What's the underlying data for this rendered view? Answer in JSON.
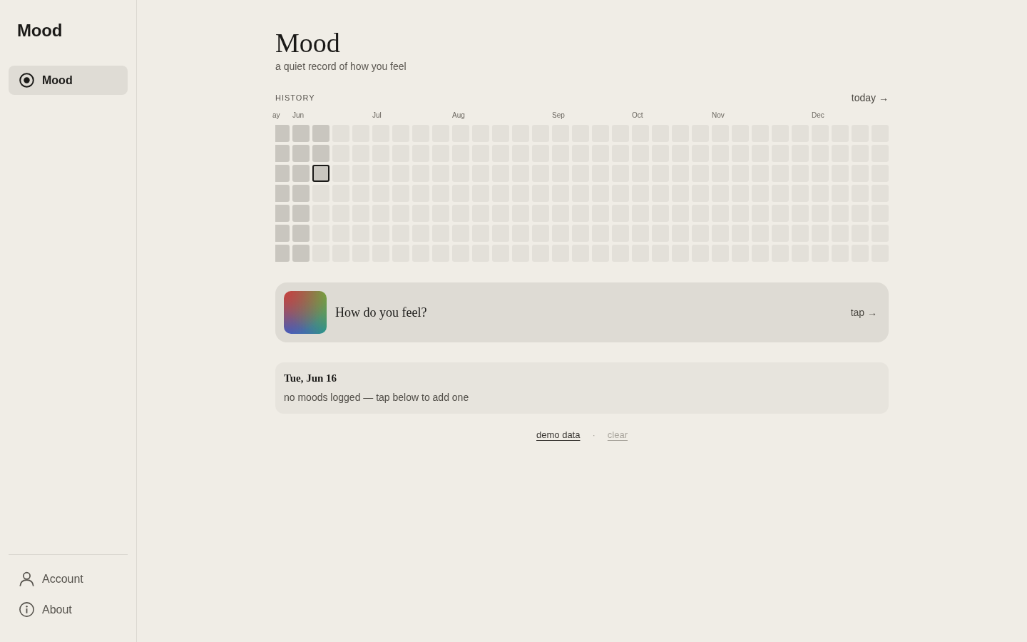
{
  "sidebar": {
    "logo": "Mood",
    "nav": [
      {
        "label": "Mood",
        "selected": true
      }
    ],
    "footer_nav": [
      {
        "label": "Account",
        "selected": false
      },
      {
        "label": "About",
        "selected": false
      }
    ]
  },
  "header": {
    "title": "Mood",
    "subtitle": "a quiet record of how you feel"
  },
  "history": {
    "label": "HISTORY",
    "today_link": "today →",
    "weeks": [
      {
        "month": "ay",
        "days": [
          {
            "past": true,
            "selected": false
          },
          {
            "past": true,
            "selected": false
          },
          {
            "past": true,
            "selected": false
          },
          {
            "past": true,
            "selected": false
          },
          {
            "past": true,
            "selected": false
          },
          {
            "past": true,
            "selected": false
          },
          {
            "past": true,
            "selected": false
          }
        ]
      },
      {
        "month": "Jun",
        "days": [
          {
            "past": true,
            "selected": false
          },
          {
            "past": true,
            "selected": false
          },
          {
            "past": true,
            "selected": false
          },
          {
            "past": true,
            "selected": false
          },
          {
            "past": true,
            "selected": false
          },
          {
            "past": true,
            "selected": false
          },
          {
            "past": true,
            "selected": false
          }
        ]
      },
      {
        "days": [
          {
            "past": true,
            "selected": false
          },
          {
            "past": true,
            "selected": false
          },
          {
            "past": true,
            "selected": true
          },
          {
            "past": false,
            "selected": false
          },
          {
            "past": false,
            "selected": false
          },
          {
            "past": false,
            "selected": false
          },
          {
            "past": false,
            "selected": false
          }
        ]
      },
      {
        "days": [
          {
            "past": false,
            "selected": false
          },
          {
            "past": false,
            "selected": false
          },
          {
            "past": false,
            "selected": false
          },
          {
            "past": false,
            "selected": false
          },
          {
            "past": false,
            "selected": false
          },
          {
            "past": false,
            "selected": false
          },
          {
            "past": false,
            "selected": false
          }
        ]
      },
      {
        "days": [
          {
            "past": false,
            "selected": false
          },
          {
            "past": false,
            "selected": false
          },
          {
            "past": false,
            "selected": false
          },
          {
            "past": false,
            "selected": false
          },
          {
            "past": false,
            "selected": false
          },
          {
            "past": false,
            "selected": false
          },
          {
            "past": false,
            "selected": false
          }
        ]
      },
      {
        "month": "Jul",
        "days": [
          {
            "past": false,
            "selected": false
          },
          {
            "past": false,
            "selected": false
          },
          {
            "past": false,
            "selected": false
          },
          {
            "past": false,
            "selected": false
          },
          {
            "past": false,
            "selected": false
          },
          {
            "past": false,
            "selected": false
          },
          {
            "past": false,
            "selected": false
          }
        ]
      },
      {
        "days": [
          {
            "past": false,
            "selected": false
          },
          {
            "past": false,
            "selected": false
          },
          {
            "past": false,
            "selected": false
          },
          {
            "past": false,
            "selected": false
          },
          {
            "past": false,
            "selected": false
          },
          {
            "past": false,
            "selected": false
          },
          {
            "past": false,
            "selected": false
          }
        ]
      },
      {
        "days": [
          {
            "past": false,
            "selected": false
          },
          {
            "past": false,
            "selected": false
          },
          {
            "past": false,
            "selected": false
          },
          {
            "past": false,
            "selected": false
          },
          {
            "past": false,
            "selected": false
          },
          {
            "past": false,
            "selected": false
          },
          {
            "past": false,
            "selected": false
          }
        ]
      },
      {
        "days": [
          {
            "past": false,
            "selected": false
          },
          {
            "past": false,
            "selected": false
          },
          {
            "past": false,
            "selected": false
          },
          {
            "past": false,
            "selected": false
          },
          {
            "past": false,
            "selected": false
          },
          {
            "past": false,
            "selected": false
          },
          {
            "past": false,
            "selected": false
          }
        ]
      },
      {
        "month": "Aug",
        "days": [
          {
            "past": false,
            "selected": false
          },
          {
            "past": false,
            "selected": false
          },
          {
            "past": false,
            "selected": false
          },
          {
            "past": false,
            "selected": false
          },
          {
            "past": false,
            "selected": false
          },
          {
            "past": false,
            "selected": false
          },
          {
            "past": false,
            "selected": false
          }
        ]
      },
      {
        "days": [
          {
            "past": false,
            "selected": false
          },
          {
            "past": false,
            "selected": false
          },
          {
            "past": false,
            "selected": false
          },
          {
            "past": false,
            "selected": false
          },
          {
            "past": false,
            "selected": false
          },
          {
            "past": false,
            "selected": false
          },
          {
            "past": false,
            "selected": false
          }
        ]
      },
      {
        "days": [
          {
            "past": false,
            "selected": false
          },
          {
            "past": false,
            "selected": false
          },
          {
            "past": false,
            "selected": false
          },
          {
            "past": false,
            "selected": false
          },
          {
            "past": false,
            "selected": false
          },
          {
            "past": false,
            "selected": false
          },
          {
            "past": false,
            "selected": false
          }
        ]
      },
      {
        "days": [
          {
            "past": false,
            "selected": false
          },
          {
            "past": false,
            "selected": false
          },
          {
            "past": false,
            "selected": false
          },
          {
            "past": false,
            "selected": false
          },
          {
            "past": false,
            "selected": false
          },
          {
            "past": false,
            "selected": false
          },
          {
            "past": false,
            "selected": false
          }
        ]
      },
      {
        "days": [
          {
            "past": false,
            "selected": false
          },
          {
            "past": false,
            "selected": false
          },
          {
            "past": false,
            "selected": false
          },
          {
            "past": false,
            "selected": false
          },
          {
            "past": false,
            "selected": false
          },
          {
            "past": false,
            "selected": false
          },
          {
            "past": false,
            "selected": false
          }
        ]
      },
      {
        "month": "Sep",
        "days": [
          {
            "past": false,
            "selected": false
          },
          {
            "past": false,
            "selected": false
          },
          {
            "past": false,
            "selected": false
          },
          {
            "past": false,
            "selected": false
          },
          {
            "past": false,
            "selected": false
          },
          {
            "past": false,
            "selected": false
          },
          {
            "past": false,
            "selected": false
          }
        ]
      },
      {
        "days": [
          {
            "past": false,
            "selected": false
          },
          {
            "past": false,
            "selected": false
          },
          {
            "past": false,
            "selected": false
          },
          {
            "past": false,
            "selected": false
          },
          {
            "past": false,
            "selected": false
          },
          {
            "past": false,
            "selected": false
          },
          {
            "past": false,
            "selected": false
          }
        ]
      },
      {
        "days": [
          {
            "past": false,
            "selected": false
          },
          {
            "past": false,
            "selected": false
          },
          {
            "past": false,
            "selected": false
          },
          {
            "past": false,
            "selected": false
          },
          {
            "past": false,
            "selected": false
          },
          {
            "past": false,
            "selected": false
          },
          {
            "past": false,
            "selected": false
          }
        ]
      },
      {
        "days": [
          {
            "past": false,
            "selected": false
          },
          {
            "past": false,
            "selected": false
          },
          {
            "past": false,
            "selected": false
          },
          {
            "past": false,
            "selected": false
          },
          {
            "past": false,
            "selected": false
          },
          {
            "past": false,
            "selected": false
          },
          {
            "past": false,
            "selected": false
          }
        ]
      },
      {
        "month": "Oct",
        "days": [
          {
            "past": false,
            "selected": false
          },
          {
            "past": false,
            "selected": false
          },
          {
            "past": false,
            "selected": false
          },
          {
            "past": false,
            "selected": false
          },
          {
            "past": false,
            "selected": false
          },
          {
            "past": false,
            "selected": false
          },
          {
            "past": false,
            "selected": false
          }
        ]
      },
      {
        "days": [
          {
            "past": false,
            "selected": false
          },
          {
            "past": false,
            "selected": false
          },
          {
            "past": false,
            "selected": false
          },
          {
            "past": false,
            "selected": false
          },
          {
            "past": false,
            "selected": false
          },
          {
            "past": false,
            "selected": false
          },
          {
            "past": false,
            "selected": false
          }
        ]
      },
      {
        "days": [
          {
            "past": false,
            "selected": false
          },
          {
            "past": false,
            "selected": false
          },
          {
            "past": false,
            "selected": false
          },
          {
            "past": false,
            "selected": false
          },
          {
            "past": false,
            "selected": false
          },
          {
            "past": false,
            "selected": false
          },
          {
            "past": false,
            "selected": false
          }
        ]
      },
      {
        "days": [
          {
            "past": false,
            "selected": false
          },
          {
            "past": false,
            "selected": false
          },
          {
            "past": false,
            "selected": false
          },
          {
            "past": false,
            "selected": false
          },
          {
            "past": false,
            "selected": false
          },
          {
            "past": false,
            "selected": false
          },
          {
            "past": false,
            "selected": false
          }
        ]
      },
      {
        "month": "Nov",
        "days": [
          {
            "past": false,
            "selected": false
          },
          {
            "past": false,
            "selected": false
          },
          {
            "past": false,
            "selected": false
          },
          {
            "past": false,
            "selected": false
          },
          {
            "past": false,
            "selected": false
          },
          {
            "past": false,
            "selected": false
          },
          {
            "past": false,
            "selected": false
          }
        ]
      },
      {
        "days": [
          {
            "past": false,
            "selected": false
          },
          {
            "past": false,
            "selected": false
          },
          {
            "past": false,
            "selected": false
          },
          {
            "past": false,
            "selected": false
          },
          {
            "past": false,
            "selected": false
          },
          {
            "past": false,
            "selected": false
          },
          {
            "past": false,
            "selected": false
          }
        ]
      },
      {
        "days": [
          {
            "past": false,
            "selected": false
          },
          {
            "past": false,
            "selected": false
          },
          {
            "past": false,
            "selected": false
          },
          {
            "past": false,
            "selected": false
          },
          {
            "past": false,
            "selected": false
          },
          {
            "past": false,
            "selected": false
          },
          {
            "past": false,
            "selected": false
          }
        ]
      },
      {
        "days": [
          {
            "past": false,
            "selected": false
          },
          {
            "past": false,
            "selected": false
          },
          {
            "past": false,
            "selected": false
          },
          {
            "past": false,
            "selected": false
          },
          {
            "past": false,
            "selected": false
          },
          {
            "past": false,
            "selected": false
          },
          {
            "past": false,
            "selected": false
          }
        ]
      },
      {
        "days": [
          {
            "past": false,
            "selected": false
          },
          {
            "past": false,
            "selected": false
          },
          {
            "past": false,
            "selected": false
          },
          {
            "past": false,
            "selected": false
          },
          {
            "past": false,
            "selected": false
          },
          {
            "past": false,
            "selected": false
          },
          {
            "past": false,
            "selected": false
          }
        ]
      },
      {
        "month": "Dec",
        "days": [
          {
            "past": false,
            "selected": false
          },
          {
            "past": false,
            "selected": false
          },
          {
            "past": false,
            "selected": false
          },
          {
            "past": false,
            "selected": false
          },
          {
            "past": false,
            "selected": false
          },
          {
            "past": false,
            "selected": false
          },
          {
            "past": false,
            "selected": false
          }
        ]
      },
      {
        "days": [
          {
            "past": false,
            "selected": false
          },
          {
            "past": false,
            "selected": false
          },
          {
            "past": false,
            "selected": false
          },
          {
            "past": false,
            "selected": false
          },
          {
            "past": false,
            "selected": false
          },
          {
            "past": false,
            "selected": false
          },
          {
            "past": false,
            "selected": false
          }
        ]
      },
      {
        "days": [
          {
            "past": false,
            "selected": false
          },
          {
            "past": false,
            "selected": false
          },
          {
            "past": false,
            "selected": false
          },
          {
            "past": false,
            "selected": false
          },
          {
            "past": false,
            "selected": false
          },
          {
            "past": false,
            "selected": false
          },
          {
            "past": false,
            "selected": false
          }
        ]
      },
      {
        "days": [
          {
            "past": false,
            "selected": false
          },
          {
            "past": false,
            "selected": false
          },
          {
            "past": false,
            "selected": false
          },
          {
            "past": false,
            "selected": false
          },
          {
            "past": false,
            "selected": false
          },
          {
            "past": false,
            "selected": false
          },
          {
            "past": false,
            "selected": false
          }
        ]
      }
    ]
  },
  "mood_prompt": {
    "question": "How do you feel?",
    "action": "tap →"
  },
  "day_detail": {
    "date": "Tue, Jun 16",
    "message": "no moods logged — tap below to add one"
  },
  "footer_links": [
    {
      "label": "demo data",
      "disabled": false
    },
    {
      "label": "clear",
      "disabled": true
    }
  ],
  "footer_separator": "·"
}
